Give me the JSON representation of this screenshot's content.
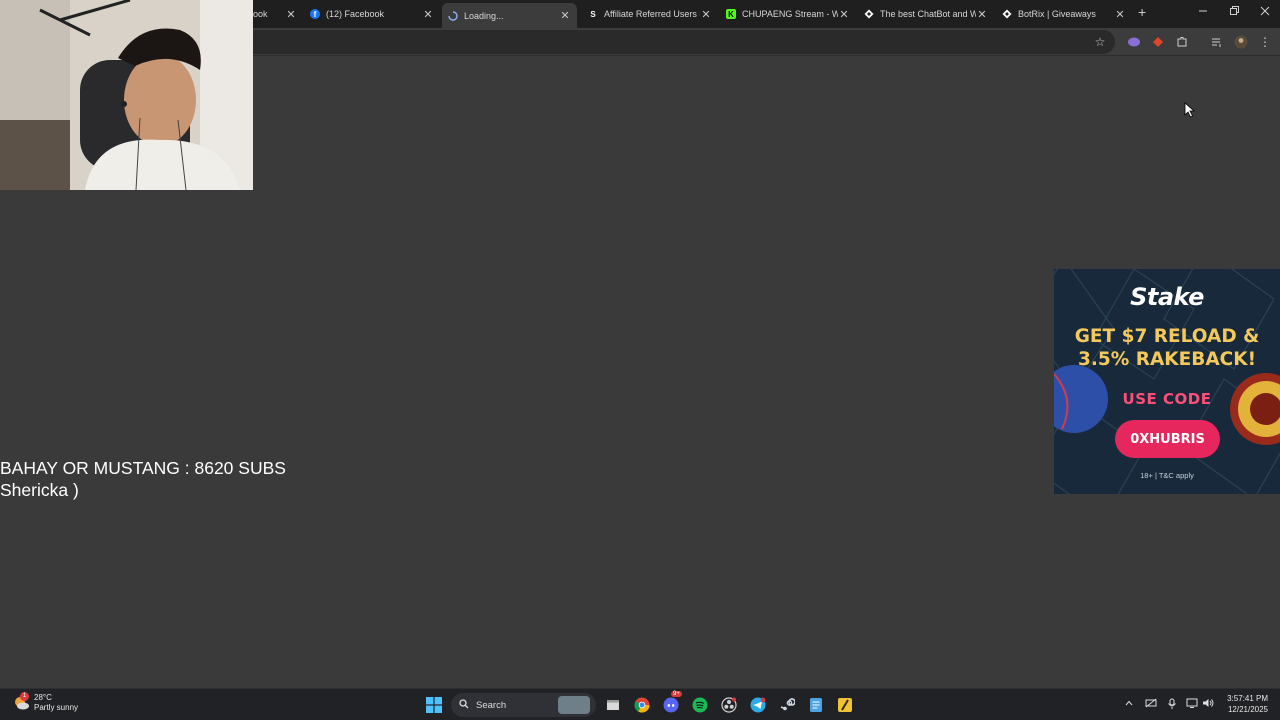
{
  "browser": {
    "tabs": [
      {
        "label": "ook",
        "favicon": "facebook-icon",
        "active": false
      },
      {
        "label": "(12) Facebook",
        "favicon": "facebook-icon",
        "active": false
      },
      {
        "label": "Loading...",
        "favicon": "loading-spinner-icon",
        "active": true
      },
      {
        "label": "Affiliate Referred Users - S",
        "favicon": "stake-s-icon",
        "active": false
      },
      {
        "label": "CHUPAENG Stream - Wa",
        "favicon": "kick-icon",
        "active": false
      },
      {
        "label": "The best ChatBot and Wi",
        "favicon": "botrix-icon",
        "active": false
      },
      {
        "label": "BotRix | Giveaways",
        "favicon": "botrix-icon",
        "active": false
      }
    ],
    "close_glyph": "✕",
    "new_tab_glyph": "+"
  },
  "stream_overlay": {
    "line1": "BAHAY OR MUSTANG : 8620 SUBS",
    "line2": "Shericka )"
  },
  "ad": {
    "logo": "Stake",
    "headline_line1": "GET $7 RELOAD &",
    "headline_line2": "3.5% RAKEBACK!",
    "code_label": "USE CODE",
    "code": "0XHUBRIS",
    "fine_print": "18+ | T&C apply",
    "colors": {
      "headline": "#f4c95c",
      "button": "#e6275d",
      "code_label": "#ff4f79"
    }
  },
  "taskbar": {
    "weather_temp": "28°C",
    "weather_desc": "Partly sunny",
    "weather_badge": "1",
    "search_label": "Search",
    "discord_badge": "9+",
    "time": "3:57:41 PM",
    "date": "12/21/2025"
  }
}
